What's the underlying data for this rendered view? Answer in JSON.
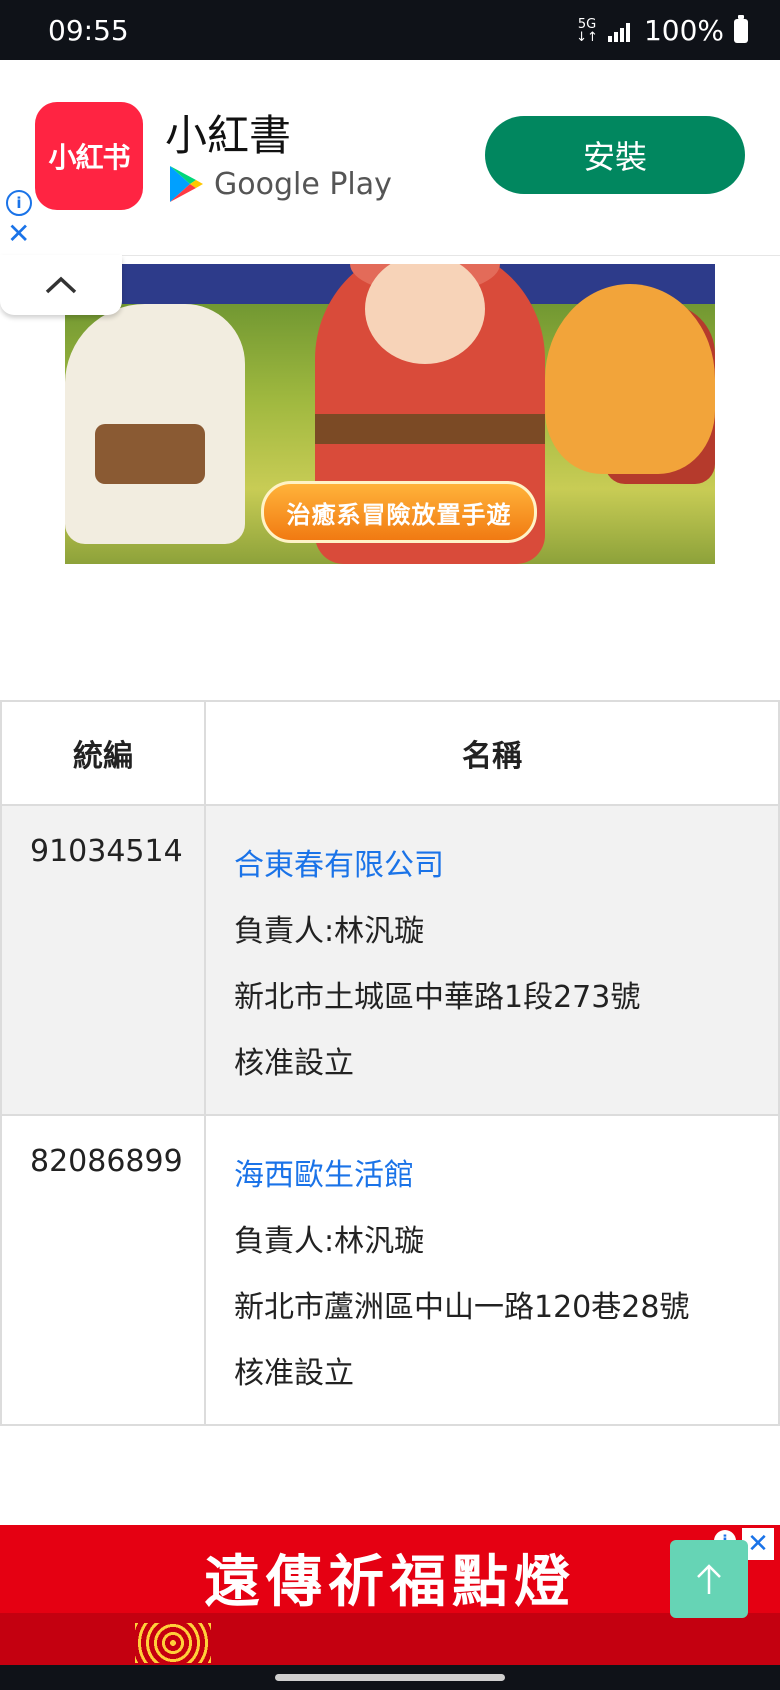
{
  "status_bar": {
    "time": "09:55",
    "network": "5G",
    "battery": "100%"
  },
  "ad_top": {
    "icon_text": "小紅书",
    "app_name": "小紅書",
    "store": "Google Play",
    "install_label": "安裝",
    "colors": {
      "icon_bg": "#ff2442",
      "install_bg": "#01875f"
    }
  },
  "banner": {
    "pill_text": "治癒系冒險放置手遊"
  },
  "table": {
    "headers": [
      "統編",
      "名稱"
    ],
    "rows": [
      {
        "tax_id": "91034514",
        "name": "合東春有限公司",
        "owner": "負責人:林汎璇",
        "address": "新北市土城區中華路1段273號",
        "status": "核准設立"
      },
      {
        "tax_id": "82086899",
        "name": "海西歐生活館",
        "owner": "負責人:林汎璇",
        "address": "新北市蘆洲區中山一路120巷28號",
        "status": "核准設立"
      }
    ]
  },
  "ad_bottom": {
    "title": "遠傳祈福點燈",
    "bg_color": "#e50012"
  },
  "colors": {
    "link": "#1a73e8",
    "scroll_top": "#66d4b5"
  }
}
